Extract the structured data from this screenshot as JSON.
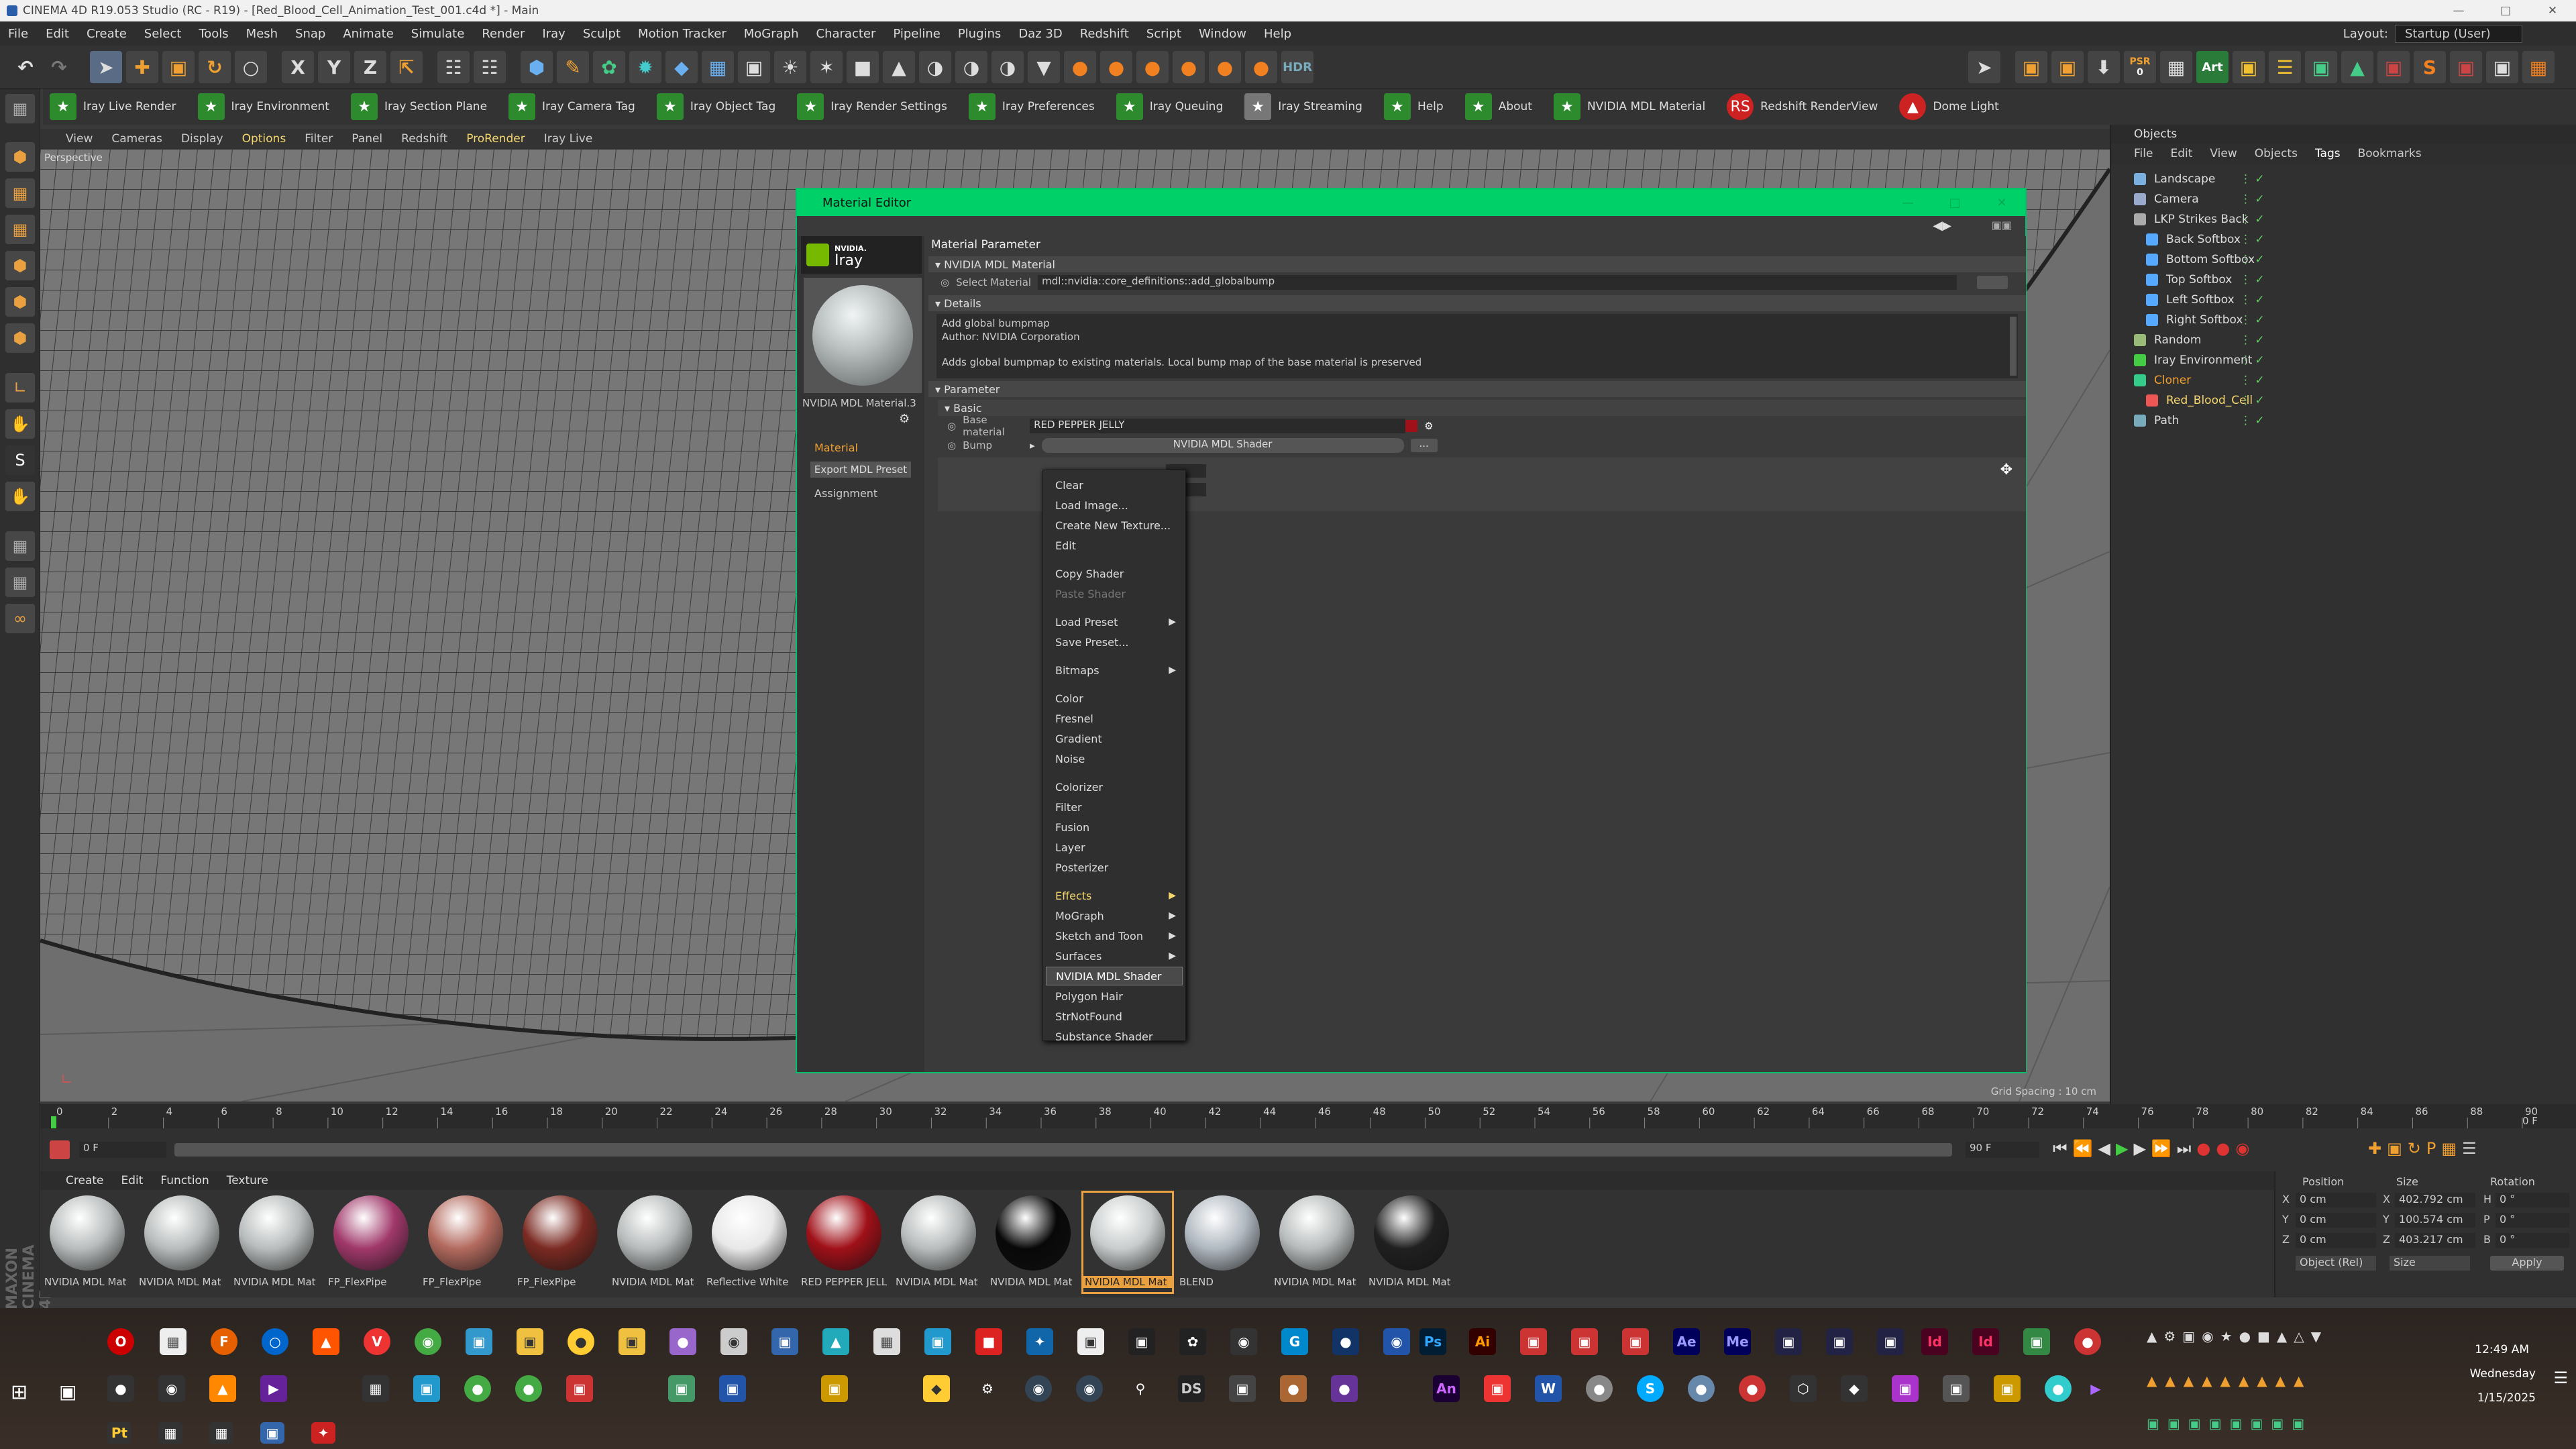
{
  "window": {
    "title": "CINEMA 4D R19.053 Studio (RC - R19) - [Red_Blood_Cell_Animation_Test_001.c4d *] - Main"
  },
  "menubar": {
    "items": [
      "File",
      "Edit",
      "Create",
      "Select",
      "Tools",
      "Mesh",
      "Snap",
      "Animate",
      "Simulate",
      "Render",
      "Iray",
      "Sculpt",
      "Motion Tracker",
      "MoGraph",
      "Character",
      "Pipeline",
      "Plugins",
      "Daz 3D",
      "Redshift",
      "Script",
      "Window",
      "Help"
    ],
    "layout_label": "Layout:",
    "layout_value": "Startup (User)"
  },
  "toolbar": {
    "axis_x": "X",
    "axis_y": "Y",
    "axis_z": "Z",
    "hdr": "HDR",
    "psr": "PSR",
    "psr_value": "0",
    "art": "Art"
  },
  "shelf": {
    "items": [
      "Iray Live Render",
      "Iray Environment",
      "Iray Section Plane",
      "Iray Camera Tag",
      "Iray Object Tag",
      "Iray Render Settings",
      "Iray Preferences",
      "Iray Queuing",
      "Iray Streaming",
      "Help",
      "About",
      "NVIDIA MDL Material",
      "Redshift RenderView",
      "Dome Light"
    ]
  },
  "viewport": {
    "menu": [
      "View",
      "Cameras",
      "Display",
      "Options",
      "Filter",
      "Panel",
      "Redshift",
      "ProRender",
      "Iray Live"
    ],
    "label": "Perspective",
    "grid_spacing": "Grid Spacing : 10 cm"
  },
  "objects": {
    "title": "Objects",
    "menu": [
      "File",
      "Edit",
      "View",
      "Objects",
      "Tags",
      "Bookmarks"
    ],
    "rows": [
      {
        "name": "Landscape",
        "color": "#7ab0e0"
      },
      {
        "name": "Camera",
        "color": "#9ac"
      },
      {
        "name": "LKP Strikes Back",
        "color": "#aaa"
      },
      {
        "name": "Back Softbox",
        "color": "#5af"
      },
      {
        "name": "Bottom Softbox",
        "color": "#5af"
      },
      {
        "name": "Top Softbox",
        "color": "#5af"
      },
      {
        "name": "Left Softbox",
        "color": "#5af"
      },
      {
        "name": "Right Softbox",
        "color": "#5af"
      },
      {
        "name": "Random",
        "color": "#9b7"
      },
      {
        "name": "Iray Environment",
        "color": "#4c4"
      },
      {
        "name": "Cloner",
        "color": "#3c8"
      },
      {
        "name": "Red_Blood_Cell",
        "color": "#e55"
      },
      {
        "name": "Path",
        "color": "#7ab"
      }
    ]
  },
  "material_editor": {
    "title": "Material Editor",
    "brand_top": "NVIDIA.",
    "brand": "Iray",
    "preview_name": "NVIDIA MDL Material.3",
    "nav_material": "Material",
    "nav_export": "Export MDL Preset",
    "nav_assignment": "Assignment",
    "heading": "Material Parameter",
    "section_mdl": "NVIDIA MDL Material",
    "select_material_label": "Select Material",
    "select_material_value": "mdl::nvidia::core_definitions::add_globalbump",
    "section_details": "Details",
    "details_line1": "Add global bumpmap",
    "details_line2": "Author: NVIDIA Corporation",
    "details_line3": "Adds global bumpmap to existing materials. Local bump map of the base material is preserved",
    "section_parameter": "Parameter",
    "section_basic": "Basic",
    "base_material_label": "Base material",
    "base_material_value": "RED PEPPER JELLY",
    "bump_label": "Bump",
    "bump_value": "NVIDIA MDL Shader",
    "more_btn": "..."
  },
  "context_menu": {
    "items": [
      {
        "label": "Clear",
        "state": "normal"
      },
      {
        "label": "Load Image...",
        "state": "normal"
      },
      {
        "label": "Create New Texture...",
        "state": "normal"
      },
      {
        "label": "Edit",
        "state": "normal"
      },
      {
        "label": "Copy Shader",
        "state": "normal"
      },
      {
        "label": "Paste Shader",
        "state": "disabled"
      },
      {
        "label": "Load Preset",
        "state": "normal",
        "submenu": true
      },
      {
        "label": "Save Preset...",
        "state": "normal"
      },
      {
        "label": "Bitmaps",
        "state": "normal",
        "submenu": true
      },
      {
        "label": "Color",
        "state": "normal"
      },
      {
        "label": "Fresnel",
        "state": "normal"
      },
      {
        "label": "Gradient",
        "state": "normal"
      },
      {
        "label": "Noise",
        "state": "normal"
      },
      {
        "label": "Colorizer",
        "state": "normal"
      },
      {
        "label": "Filter",
        "state": "normal"
      },
      {
        "label": "Fusion",
        "state": "normal"
      },
      {
        "label": "Layer",
        "state": "normal"
      },
      {
        "label": "Posterizer",
        "state": "normal"
      },
      {
        "label": "Effects",
        "state": "highlight",
        "submenu": true
      },
      {
        "label": "MoGraph",
        "state": "normal",
        "submenu": true
      },
      {
        "label": "Sketch and Toon",
        "state": "normal",
        "submenu": true
      },
      {
        "label": "Surfaces",
        "state": "normal",
        "submenu": true
      },
      {
        "label": "NVIDIA MDL Shader",
        "state": "selected"
      },
      {
        "label": "Polygon Hair",
        "state": "normal"
      },
      {
        "label": "StrNotFound",
        "state": "normal"
      },
      {
        "label": "Substance Shader",
        "state": "normal"
      }
    ]
  },
  "timeline": {
    "ticks": [
      "0",
      "2",
      "4",
      "6",
      "8",
      "10",
      "12",
      "14",
      "16",
      "18",
      "20",
      "22",
      "24",
      "26",
      "28",
      "30",
      "32",
      "34",
      "36",
      "38",
      "40",
      "42",
      "44",
      "46",
      "48",
      "50",
      "52",
      "54",
      "56",
      "58",
      "60",
      "62",
      "64",
      "66",
      "68",
      "70",
      "72",
      "74",
      "76",
      "78",
      "80",
      "82",
      "84",
      "86",
      "88",
      "90"
    ],
    "end_label": "0 F",
    "current_frame": "0 F",
    "start_field": "0 F",
    "end_field": "90 F",
    "end_field2": "90 F"
  },
  "material_manager": {
    "menu": [
      "Create",
      "Edit",
      "Function",
      "Texture"
    ],
    "materials": [
      {
        "name": "NVIDIA MDL Mat",
        "color": "#b8bcbc",
        "active": false
      },
      {
        "name": "NVIDIA MDL Mat",
        "color": "#b8bcbc",
        "active": false
      },
      {
        "name": "NVIDIA MDL Mat",
        "color": "#b8bcbc",
        "active": false
      },
      {
        "name": "FP_FlexPipe",
        "color": "#a0386a",
        "active": false
      },
      {
        "name": "FP_FlexPipe",
        "color": "#b36a5e",
        "active": false
      },
      {
        "name": "FP_FlexPipe",
        "color": "#7a2a22",
        "active": false
      },
      {
        "name": "NVIDIA MDL Mat",
        "color": "#b8bcbc",
        "active": false
      },
      {
        "name": "Reflective White",
        "color": "#e8e8e8",
        "active": false
      },
      {
        "name": "RED PEPPER JELL",
        "color": "#a01018",
        "active": false
      },
      {
        "name": "NVIDIA MDL Mat",
        "color": "#b8bcbc",
        "active": false
      },
      {
        "name": "NVIDIA MDL Mat",
        "color": "#080808",
        "active": false
      },
      {
        "name": "NVIDIA MDL Mat",
        "color": "#c8cccc",
        "active": true
      },
      {
        "name": "BLEND",
        "color": "#b0b8c0",
        "active": false
      },
      {
        "name": "NVIDIA MDL Mat",
        "color": "#b8bcbc",
        "active": false
      },
      {
        "name": "NVIDIA MDL Mat",
        "color": "#202020",
        "active": false
      }
    ],
    "brand": "MAXON CINEMA 4D"
  },
  "coords": {
    "h_position": "Position",
    "h_size": "Size",
    "h_rotation": "Rotation",
    "rows": [
      {
        "axis": "X",
        "pos": "0 cm",
        "size_axis": "X",
        "size": "402.792 cm",
        "rot_axis": "H",
        "rot": "0 °"
      },
      {
        "axis": "Y",
        "pos": "0 cm",
        "size_axis": "Y",
        "size": "100.574 cm",
        "rot_axis": "P",
        "rot": "0 °"
      },
      {
        "axis": "Z",
        "pos": "0 cm",
        "size_axis": "Z",
        "size": "403.217 cm",
        "rot_axis": "B",
        "rot": "0 °"
      }
    ],
    "mode1": "Object (Rel)",
    "mode2": "Size",
    "apply": "Apply"
  },
  "taskbar": {
    "time": "12:49 AM",
    "day": "Wednesday",
    "date": "1/15/2025",
    "app_labels": [
      "Ps",
      "Ai",
      "Ae",
      "Me",
      "Id",
      "Id",
      "An",
      "DS",
      "Pt"
    ]
  },
  "colors": {
    "accent_green": "#00d068",
    "selected_material_border": "#e8a040"
  }
}
